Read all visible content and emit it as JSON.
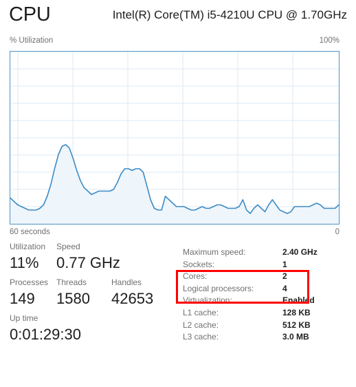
{
  "header": {
    "title": "CPU",
    "model": "Intel(R) Core(TM) i5-4210U CPU @ 1.70GHz"
  },
  "chart_axes": {
    "y_label": "% Utilization",
    "y_max_label": "100%",
    "x_left_label": "60 seconds",
    "x_right_label": "0"
  },
  "stats": {
    "utilization": {
      "label": "Utilization",
      "value": "11%"
    },
    "speed": {
      "label": "Speed",
      "value": "0.77 GHz"
    },
    "processes": {
      "label": "Processes",
      "value": "149"
    },
    "threads": {
      "label": "Threads",
      "value": "1580"
    },
    "handles": {
      "label": "Handles",
      "value": "42653"
    },
    "uptime": {
      "label": "Up time",
      "value": "0:01:29:30"
    }
  },
  "specs": [
    {
      "label": "Maximum speed:",
      "value": "2.40 GHz"
    },
    {
      "label": "Sockets:",
      "value": "1"
    },
    {
      "label": "Cores:",
      "value": "2"
    },
    {
      "label": "Logical processors:",
      "value": "4"
    },
    {
      "label": "Virtualization:",
      "value": "Enabled"
    },
    {
      "label": "L1 cache:",
      "value": "128 KB"
    },
    {
      "label": "L2 cache:",
      "value": "512 KB"
    },
    {
      "label": "L3 cache:",
      "value": "3.0 MB"
    }
  ],
  "annotation": {
    "color": "#ff0000",
    "highlights": [
      "Cores:",
      "Logical processors:"
    ]
  },
  "colors": {
    "line": "#3d8bc4",
    "fill": "#eef5fb",
    "border": "#4a93c9",
    "grid": "#dbeaf6",
    "label_text": "#6f6f6f",
    "value_text": "#1d1d1d"
  },
  "chart_data": {
    "type": "area",
    "title": "% Utilization",
    "xlabel": "60 seconds",
    "ylabel": "% Utilization",
    "ylim": [
      0,
      100
    ],
    "xlim": [
      60,
      0
    ],
    "grid": true,
    "legend": null,
    "y_gridline_step": 10,
    "x_gridline_count": 6,
    "series": [
      {
        "name": "CPU Utilization",
        "values": [
          15,
          13,
          11,
          10,
          9,
          8,
          8,
          8,
          9,
          11,
          16,
          23,
          32,
          40,
          45,
          46,
          44,
          38,
          31,
          25,
          21,
          19,
          17,
          18,
          19,
          19,
          19,
          19,
          20,
          24,
          29,
          32,
          32,
          31,
          32,
          32,
          30,
          22,
          14,
          9,
          8,
          8,
          16,
          14,
          12,
          10,
          10,
          10,
          9,
          8,
          8,
          9,
          10,
          9,
          9,
          10,
          11,
          11,
          10,
          9,
          9,
          9,
          10,
          14,
          8,
          6,
          9,
          11,
          9,
          7,
          11,
          14,
          11,
          8,
          7,
          6,
          7,
          10,
          10,
          10,
          10,
          10,
          11,
          12,
          11,
          9,
          9,
          9,
          9,
          11
        ]
      }
    ]
  }
}
